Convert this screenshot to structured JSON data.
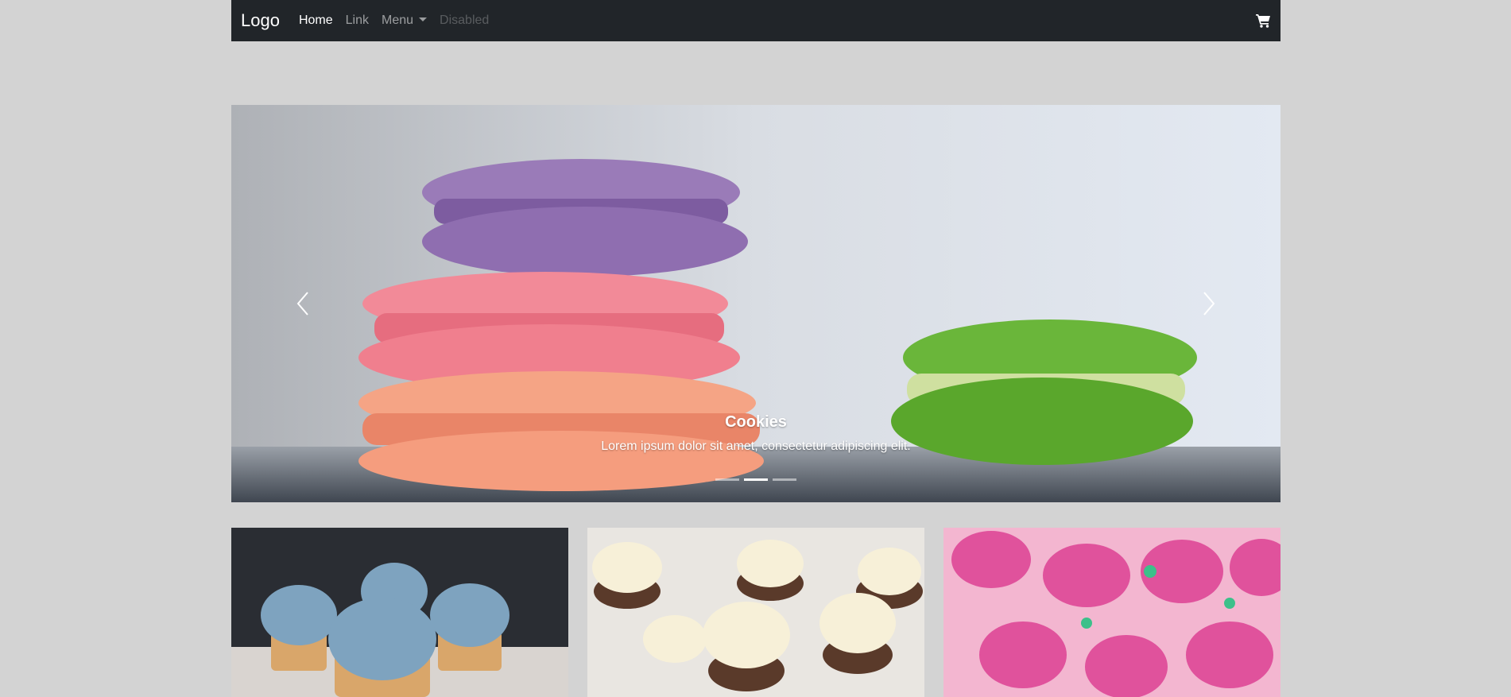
{
  "navbar": {
    "brand": "Logo",
    "links": [
      {
        "label": "Home",
        "state": "active"
      },
      {
        "label": "Link",
        "state": "normal"
      },
      {
        "label": "Menu",
        "state": "dropdown"
      },
      {
        "label": "Disabled",
        "state": "disabled"
      }
    ],
    "cart_icon": "shopping-cart-icon"
  },
  "carousel": {
    "caption_title": "Cookies",
    "caption_text": "Lorem ipsum dolor sit amet, consectetur adipiscing elit.",
    "indicators": 3,
    "active_indicator": 2,
    "prev_icon": "chevron-left-icon",
    "next_icon": "chevron-right-icon"
  },
  "colors": {
    "navbar_bg": "#212529",
    "page_bg": "#d3d3d3"
  }
}
